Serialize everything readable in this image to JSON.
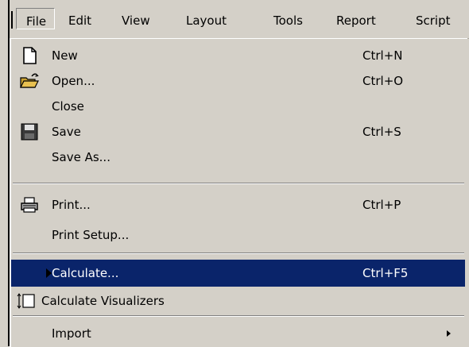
{
  "menubar": {
    "items": [
      "File",
      "Edit",
      "View",
      "Layout",
      "Tools",
      "Report",
      "Script"
    ]
  },
  "file_menu": {
    "items": [
      {
        "label": "New",
        "shortcut": "Ctrl+N",
        "icon": "new-document-icon"
      },
      {
        "label": "Open...",
        "shortcut": "Ctrl+O",
        "icon": "open-folder-icon"
      },
      {
        "label": "Close",
        "shortcut": ""
      },
      {
        "label": "Save",
        "shortcut": "Ctrl+S",
        "icon": "save-disk-icon"
      },
      {
        "label": "Save As...",
        "shortcut": ""
      },
      {
        "label": "Print...",
        "shortcut": "Ctrl+P",
        "icon": "printer-icon"
      },
      {
        "label": "Print Setup...",
        "shortcut": ""
      },
      {
        "label": "Calculate...",
        "shortcut": "Ctrl+F5",
        "selected": true
      },
      {
        "label": "Calculate Visualizers",
        "shortcut": "",
        "icon": "calculate-visualizers-icon"
      },
      {
        "label": "Import",
        "shortcut": "",
        "submenu": true
      }
    ]
  },
  "colors": {
    "menu_bg": "#d4d0c8",
    "highlight": "#0a246a",
    "highlight_text": "#ffffff"
  }
}
